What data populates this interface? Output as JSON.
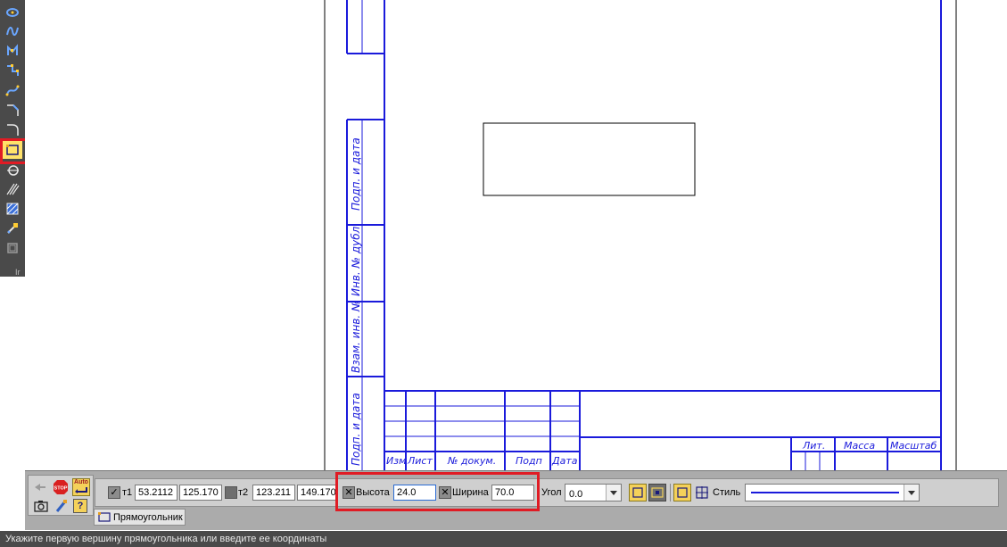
{
  "toolbar": {
    "tools": [
      {
        "name": "ellipse-tool",
        "icon": "ellipse-icon"
      },
      {
        "name": "spline-tool",
        "icon": "spline-icon"
      },
      {
        "name": "polyline-tool",
        "icon": "polyline-icon"
      },
      {
        "name": "broken-line-tool",
        "icon": "broken-line-icon"
      },
      {
        "name": "bezier-tool",
        "icon": "bezier-icon"
      },
      {
        "name": "chamfer-tool",
        "icon": "chamfer-icon"
      },
      {
        "name": "fillet-tool",
        "icon": "fillet-icon"
      },
      {
        "name": "rectangle-tool",
        "icon": "rectangle-icon",
        "active": true
      },
      {
        "name": "circle-tangent-tool",
        "icon": "circle-tangent-icon"
      },
      {
        "name": "hatch-tool",
        "icon": "hatch-icon"
      },
      {
        "name": "fill-tool",
        "icon": "fill-icon"
      },
      {
        "name": "contour-tool",
        "icon": "contour-icon"
      },
      {
        "name": "equidistant-tool",
        "icon": "equidistant-icon"
      }
    ]
  },
  "sheet": {
    "side_labels": [
      "Подп. и дата",
      "Инв. № дубл.",
      "Взам. инв. №",
      "Подп. и дата"
    ],
    "stamp_headers": [
      "Изм",
      "Лист",
      "№ докум.",
      "Подп",
      "Дата"
    ],
    "title_headers": [
      "Лит.",
      "Масса",
      "Масштаб"
    ]
  },
  "panel": {
    "stop_label": "STOP",
    "auto_label": "Auto",
    "t1_label": "т1",
    "t1_x": "53.2112",
    "t1_y": "125.170",
    "t2_label": "т2",
    "t2_x": "123.211",
    "t2_y": "149.170",
    "height_label": "Высота",
    "height_value": "24.0",
    "width_label": "Ширина",
    "width_value": "70.0",
    "angle_label": "Угол",
    "angle_value": "0.0",
    "style_label": "Стиль",
    "tab_label": "Прямоугольник"
  },
  "status": {
    "text": "Укажите первую вершину прямоугольника или введите ее координаты"
  },
  "colors": {
    "frame_blue": "#1a1adb",
    "highlight_red": "#e01b24",
    "toggle_yellow": "#f4d15a"
  }
}
